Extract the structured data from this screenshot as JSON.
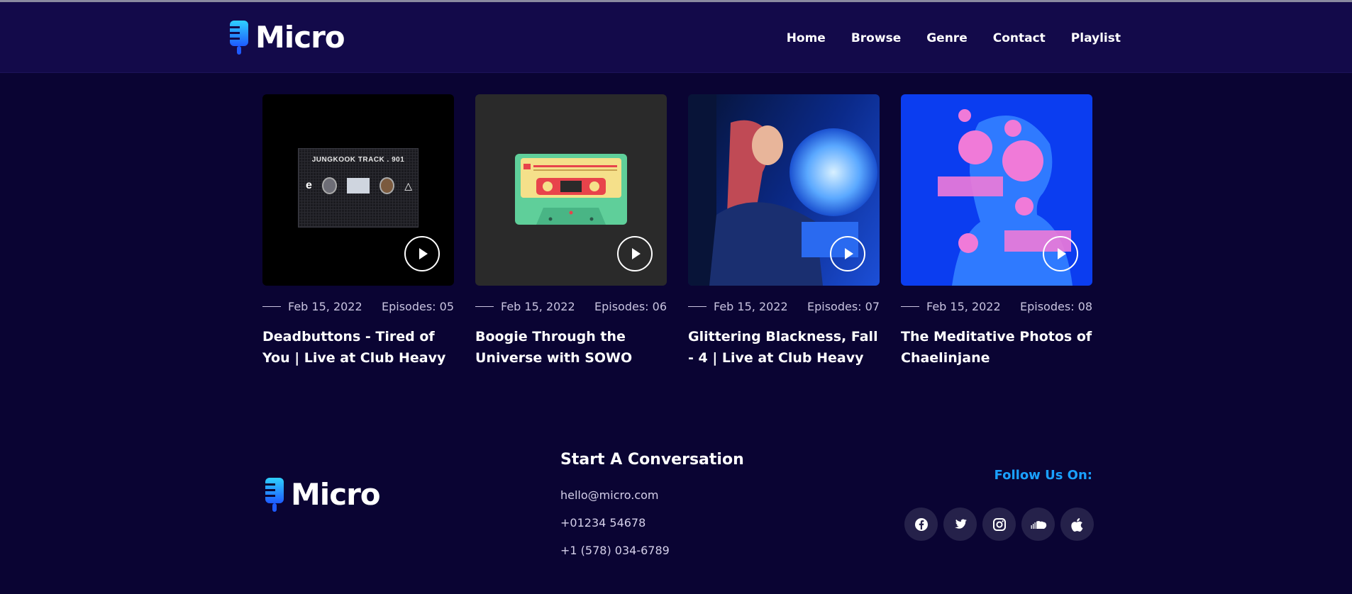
{
  "header": {
    "logo_text": "Micro",
    "nav": [
      "Home",
      "Browse",
      "Genre",
      "Contact",
      "Playlist"
    ]
  },
  "cards": [
    {
      "date": "Feb 15, 2022",
      "episodes": "Episodes: 05",
      "title": "Deadbuttons - Tired of You | Live at Club Heavy",
      "thumb_label": "JUNGKOOK TRACK . 901"
    },
    {
      "date": "Feb 15, 2022",
      "episodes": "Episodes: 06",
      "title": "Boogie Through the Universe with SOWO"
    },
    {
      "date": "Feb 15, 2022",
      "episodes": "Episodes: 07",
      "title": "Glittering Blackness, Fall - 4 | Live at Club Heavy"
    },
    {
      "date": "Feb 15, 2022",
      "episodes": "Episodes: 08",
      "title": "The Meditative Photos of Chaelinjane"
    }
  ],
  "footer": {
    "logo_text": "Micro",
    "conversation_title": "Start A Conversation",
    "email": "hello@micro.com",
    "phone1": "+01234 54678",
    "phone2": "+1 (578) 034-6789",
    "follow_label": "Follow Us On:",
    "socials": [
      "facebook-icon",
      "twitter-icon",
      "instagram-icon",
      "soundcloud-icon",
      "apple-icon"
    ]
  },
  "colors": {
    "background": "#0a0433",
    "header_bg": "#130a4a",
    "accent": "#1aa0ff",
    "social_bg": "#25214a"
  }
}
